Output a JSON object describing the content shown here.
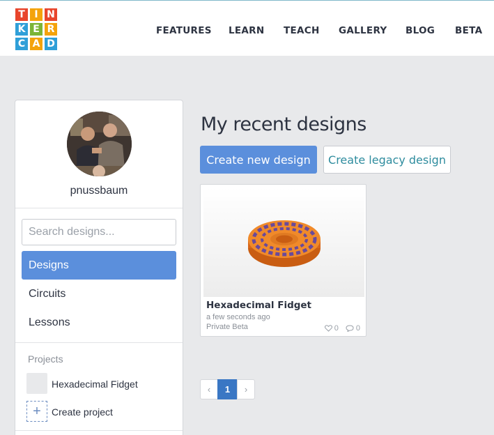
{
  "brand": {
    "logo_letters": [
      "T",
      "I",
      "N",
      "K",
      "E",
      "R",
      "C",
      "A",
      "D"
    ],
    "logo_colors": [
      "#e8452c",
      "#f4a30c",
      "#e8452c",
      "#2f9fd8",
      "#7bb537",
      "#f4a30c",
      "#2f9fd8",
      "#f4a30c",
      "#2f9fd8"
    ]
  },
  "nav": {
    "items": [
      {
        "label": "FEATURES"
      },
      {
        "label": "LEARN"
      },
      {
        "label": "TEACH"
      },
      {
        "label": "GALLERY"
      },
      {
        "label": "BLOG"
      },
      {
        "label": "BETA"
      }
    ]
  },
  "sidebar": {
    "username": "pnussbaum",
    "search_placeholder": "Search designs...",
    "items": [
      {
        "label": "Designs",
        "active": true
      },
      {
        "label": "Circuits",
        "active": false
      },
      {
        "label": "Lessons",
        "active": false
      }
    ],
    "projects_label": "Projects",
    "projects": [
      {
        "name": "Hexadecimal Fidget"
      }
    ],
    "create_project_label": "Create project"
  },
  "main": {
    "title": "My recent designs",
    "create_new_label": "Create new design",
    "create_legacy_label": "Create legacy design",
    "designs": [
      {
        "title": "Hexadecimal Fidget",
        "time": "a few seconds ago",
        "status": "Private Beta",
        "likes": "0",
        "comments": "0"
      }
    ]
  },
  "pagination": {
    "prev": "‹",
    "current": "1",
    "next": "›"
  },
  "colors": {
    "accent": "#5b8fdc",
    "page_active": "#3a77c4",
    "secondary_text": "#2e8c9e"
  }
}
